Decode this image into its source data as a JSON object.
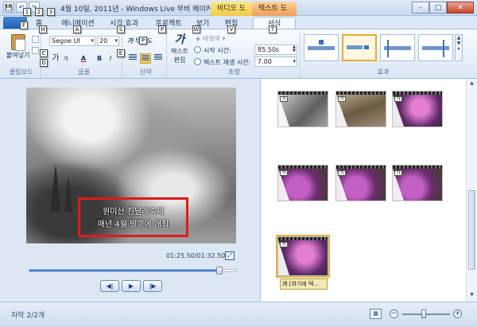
{
  "window": {
    "title": "4월 10일, 2011년 - Windows Live 무비 메이커",
    "context_tab_video": "비디오 도구",
    "context_tab_text": "텍스트 도구",
    "minimize": "–",
    "maximize": "□",
    "close": "✕"
  },
  "qat": {
    "save": "💾",
    "undo": "↶",
    "redo": "↷"
  },
  "tabs": {
    "file": "",
    "home": "홈",
    "animations": "애니메이션",
    "visual_effects": "시각 효과",
    "project": "프로젝트",
    "view": "보기",
    "edit": "편집",
    "format": "서식"
  },
  "keytips": [
    "1",
    "2",
    "3",
    "F",
    "H",
    "A",
    "S",
    "P",
    "W",
    "V",
    "T",
    "C",
    "P",
    "D",
    "E"
  ],
  "ribbon": {
    "clipboard": {
      "paste_label": "붙여넣기",
      "group_label": "클립보드"
    },
    "font": {
      "family": "Segoe UI",
      "size": "20",
      "grow": "가",
      "shrink": "가",
      "color_glyph": "A",
      "bold": "B",
      "italic": "I",
      "group_label": "글꼴"
    },
    "paragraph": {
      "transparency_label": "투명도",
      "transparency_glyph": "가",
      "group_label": "단락"
    },
    "adjust": {
      "text_edit_label_1": "텍스트",
      "text_edit_label_2": "편집",
      "text_edit_glyph": "가",
      "background_color_label": "배경색",
      "start_time_label": "시작 시간:",
      "start_time_value": "85.50s",
      "duration_label": "텍스트 재생 시간:",
      "duration_value": "7.00",
      "group_label": "조정"
    },
    "effects": {
      "group_label": "효과"
    }
  },
  "preview": {
    "caption_line1": "원미산 진달래축제",
    "caption_line2": "매년 4월 말경에 개최",
    "timecode": "01:25.50/01:32.50",
    "progress": 0.924,
    "prev_frame": "◀|",
    "play": "▶",
    "next_frame": "|▶"
  },
  "storyboard": {
    "text_icon": "가",
    "caption_tag_icon": "가",
    "caption_tag_text": "[여기에 텍..."
  },
  "status": {
    "caption_count": "자막 2/2개",
    "zoom_minus": "−",
    "zoom_plus": "+",
    "zoom_level": 0.45
  },
  "colors": {
    "accent_blue": "#1f5fb3",
    "caption_box": "#e2191a",
    "context_video": "#f0c94a",
    "context_text": "#ef9f5a",
    "selection": "#e9a93a"
  }
}
